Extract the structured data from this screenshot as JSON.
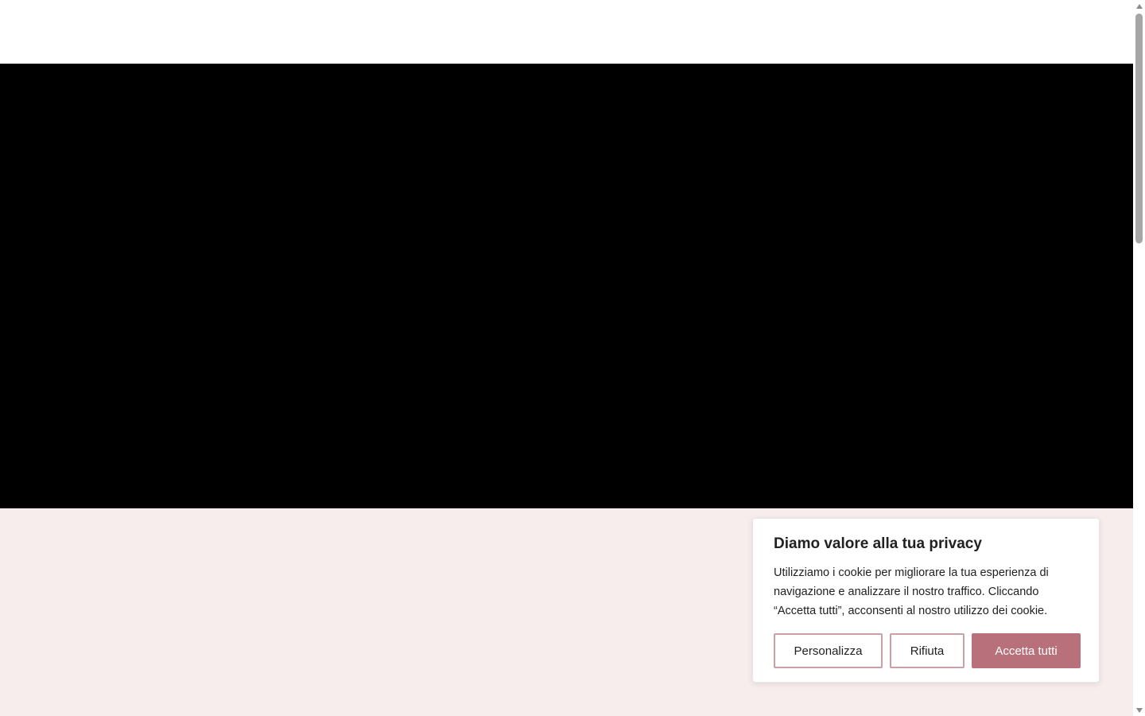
{
  "cookie_banner": {
    "title": "Diamo valore alla tua privacy",
    "message": "Utilizziamo i cookie per migliorare la tua esperienza di navigazione e analizzare il nostro traffico. Cliccando “Accetta tutti”, acconsenti al nostro utilizzo dei cookie.",
    "customize_label": "Personalizza",
    "reject_label": "Rifiuta",
    "accept_label": "Accetta tutti"
  },
  "colors": {
    "accent": "#b8707a",
    "accent_border": "#c9a0a6",
    "section_background": "#f8eded",
    "hero_background": "#000000"
  },
  "icons": {
    "scroll_up": "chevron-up-icon",
    "scroll_down": "chevron-down-icon"
  }
}
